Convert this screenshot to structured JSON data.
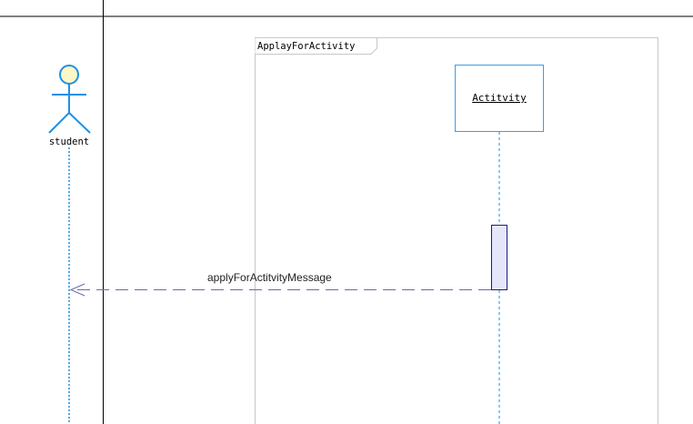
{
  "diagram": {
    "type": "sequence",
    "frame": {
      "title": "ApplayForActivity"
    },
    "actor": {
      "name": "student"
    },
    "lifeline_object": {
      "name": "Actitvity"
    },
    "message": {
      "label": "applyForActitvityMessage",
      "kind": "return"
    },
    "colors": {
      "swimlane_border": "#000000",
      "frame_border": "#c8c8c8",
      "actor_stroke": "#1e90e6",
      "actor_head_fill": "#fbf7c6",
      "object_border": "#3c9ee6",
      "lifeline": "#1e90e6",
      "activation_fill": "#e6e6fa",
      "activation_border": "#1c1c80",
      "message_line": "#6a6ab0"
    }
  }
}
